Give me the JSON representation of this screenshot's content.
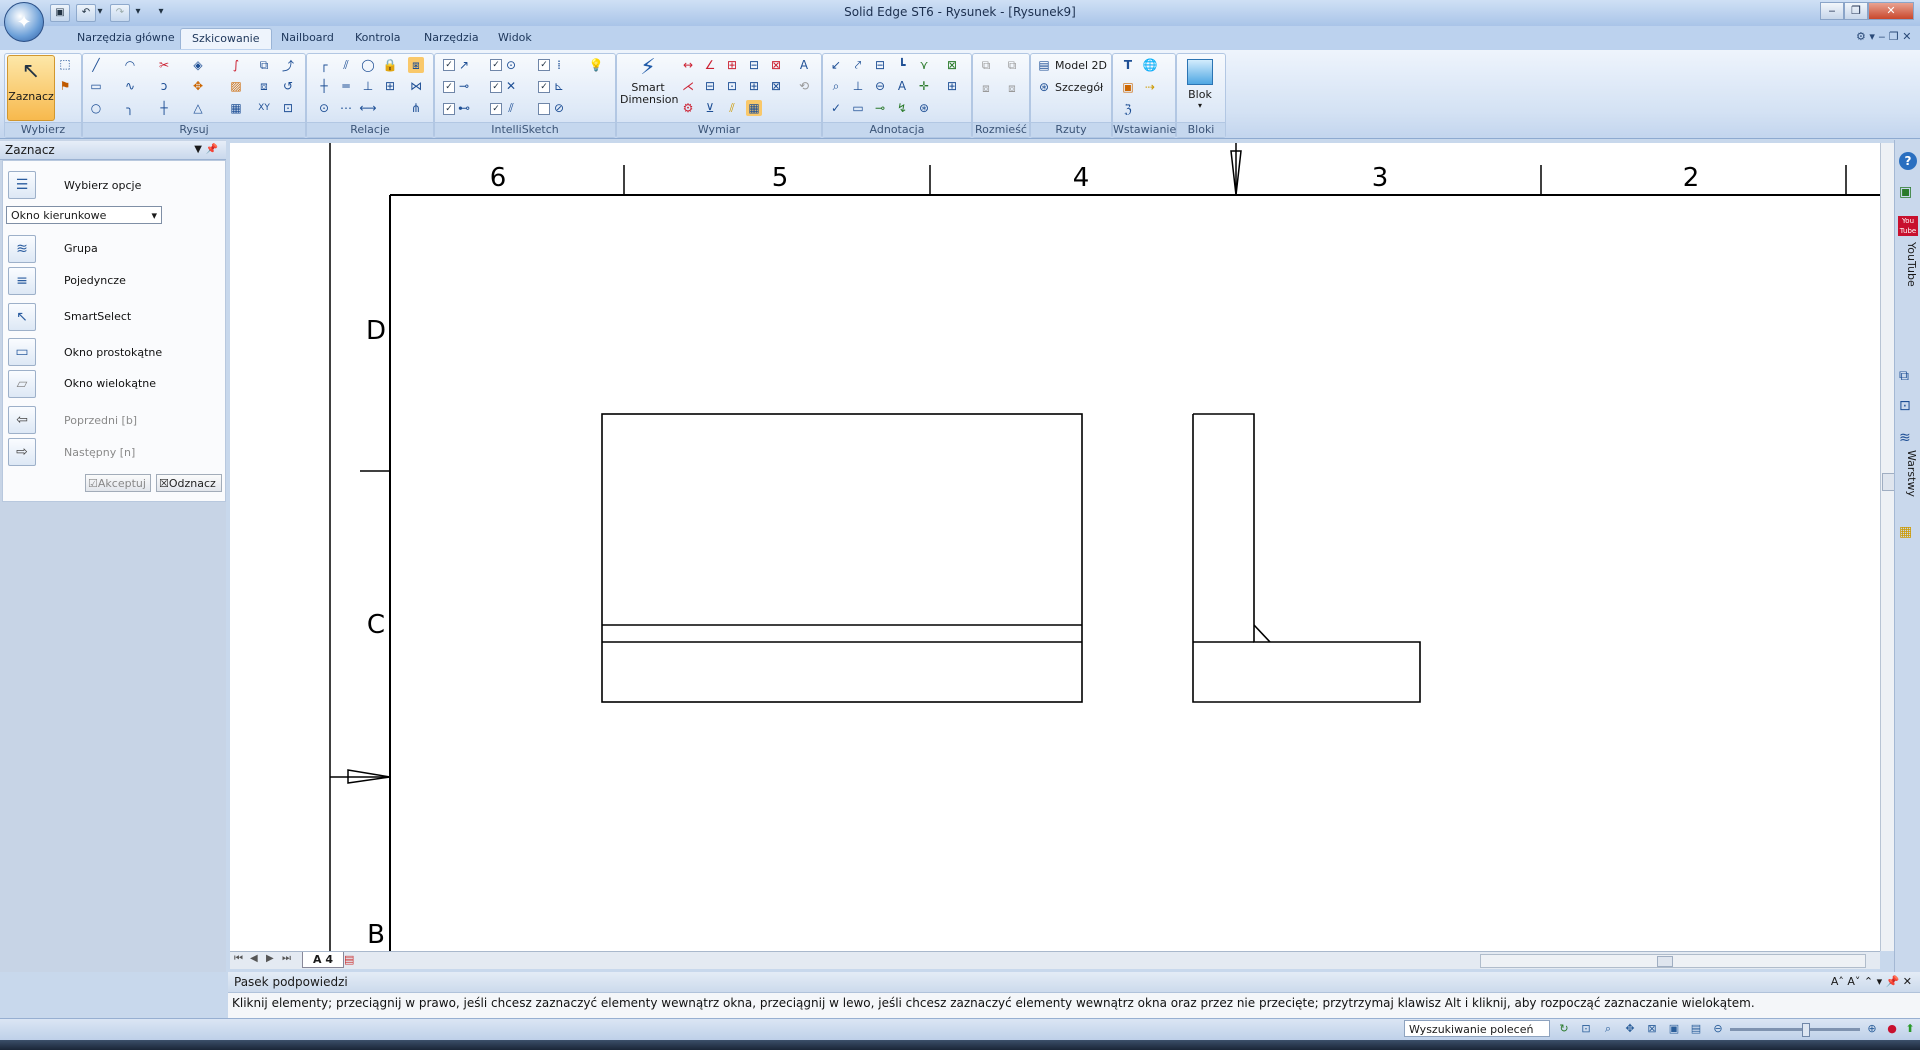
{
  "window": {
    "title": "Solid Edge ST6 - Rysunek - [Rysunek9]",
    "controls": [
      "‒",
      "❐",
      "✕"
    ]
  },
  "ribbon": {
    "tabs": [
      "Narzędzia główne",
      "Szkicowanie",
      "Nailboard",
      "Kontrola",
      "Narzędzia",
      "Widok"
    ],
    "active_tab": "Szkicowanie",
    "groups": {
      "wybierz": "Wybierz",
      "rysuj": "Rysuj",
      "relacje": "Relacje",
      "intellisketch": "IntelliSketch",
      "wymiar": "Wymiar",
      "adnotacja": "Adnotacja",
      "rozmiesc": "Rozmieść",
      "rzuty": "Rzuty",
      "wstawianie": "Wstawianie",
      "bloki": "Bloki"
    },
    "zaznacz_label": "Zaznacz",
    "smart_dimension_label1": "Smart",
    "smart_dimension_label2": "Dimension",
    "model2d_label": "Model 2D",
    "szczegol_label": "Szczegół",
    "blok_label": "Blok",
    "xy_label": "XY"
  },
  "left_panel": {
    "title": "Zaznacz",
    "select_options_label": "Wybierz opcje",
    "dropdown_value": "Okno kierunkowe",
    "items": [
      {
        "label": "Grupa",
        "enabled": true
      },
      {
        "label": "Pojedyncze",
        "enabled": true
      },
      {
        "label": "SmartSelect",
        "enabled": true
      },
      {
        "label": "Okno prostokątne",
        "enabled": true
      },
      {
        "label": "Okno wielokątne",
        "enabled": true
      },
      {
        "label": "Poprzedni [b]",
        "enabled": false
      },
      {
        "label": "Następny [n]",
        "enabled": false
      }
    ],
    "accept_label": "Akceptuj",
    "deselect_label": "Odznacz"
  },
  "drawing": {
    "column_labels": [
      "6",
      "5",
      "4",
      "3",
      "2"
    ],
    "row_labels": [
      "D",
      "C",
      "B"
    ],
    "sheet_tab": "A 4"
  },
  "right_sidebar": {
    "youtube_label": "YouTube",
    "layers_label": "Warstwy",
    "youtube_badge": "You Tube"
  },
  "prompt_bar": {
    "title": "Pasek podpowiedzi",
    "text": "Kliknij elementy; przeciągnij w prawo, jeśli chcesz zaznaczyć elementy wewnątrz okna, przeciągnij w lewo, jeśli chcesz zaznaczyć elementy wewnątrz okna oraz przez nie przecięte; przytrzymaj klawisz Alt i kliknij, aby rozpocząć zaznaczanie wielokątem."
  },
  "status_bar": {
    "command_search": "Wyszukiwanie poleceń"
  },
  "colors": {
    "ribbon_bg": "#d4e2f4",
    "active_tab": "#eef4fc",
    "selected_tool": "#f9c86a",
    "canvas": "#ffffff"
  }
}
